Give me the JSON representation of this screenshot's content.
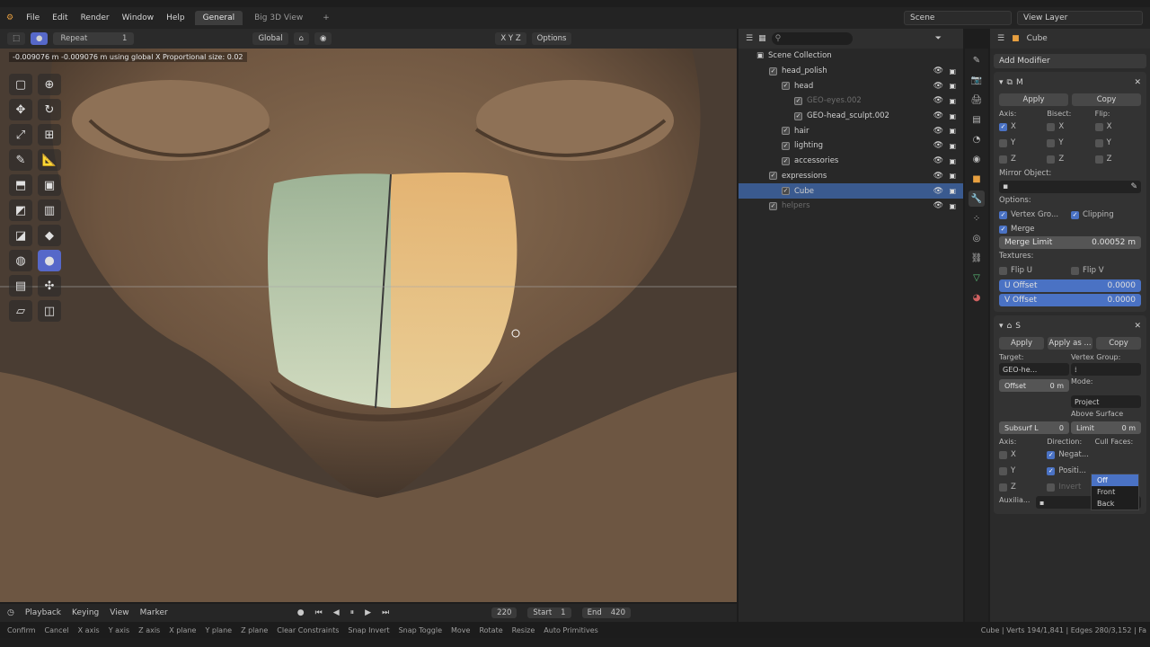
{
  "menu": {
    "file": "File",
    "edit": "Edit",
    "render": "Render",
    "window": "Window",
    "help": "Help"
  },
  "workspace_tabs": [
    "General",
    "Big 3D View"
  ],
  "scene": "Scene",
  "view_layer": "View Layer",
  "viewport_header": {
    "operator": "Repeat",
    "operator_value": "1",
    "orientation": "Global",
    "axes": "X  Y  Z",
    "options": "Options"
  },
  "op_status": "-0.009076 m -0.009076 m using global X     Proportional size: 0.02",
  "timeline": {
    "playback": "Playback",
    "keying": "Keying",
    "view": "View",
    "marker": "Marker",
    "frame": "220",
    "start_label": "Start",
    "start": "1",
    "end_label": "End",
    "end": "420"
  },
  "statusbar": {
    "items": [
      "Confirm",
      "Cancel",
      "X axis",
      "Y axis",
      "Z axis",
      "X plane",
      "Y plane",
      "Z plane",
      "Clear Constraints",
      "Snap Invert",
      "Snap Toggle",
      "Move",
      "Rotate",
      "Resize",
      "Auto Primitives"
    ],
    "stats": "Cube | Verts 194/1,841 | Edges 280/3,152 | Fa"
  },
  "outliner": {
    "title": "Scene Collection",
    "rows": [
      {
        "label": "head_polish",
        "indent": 1,
        "dim": false
      },
      {
        "label": "head",
        "indent": 2,
        "dim": false
      },
      {
        "label": "GEO-eyes.002",
        "indent": 3,
        "dim": true
      },
      {
        "label": "GEO-head_sculpt.002",
        "indent": 3,
        "dim": false
      },
      {
        "label": "hair",
        "indent": 2,
        "dim": false
      },
      {
        "label": "lighting",
        "indent": 2,
        "dim": false
      },
      {
        "label": "accessories",
        "indent": 2,
        "dim": false
      },
      {
        "label": "expressions",
        "indent": 1,
        "dim": false
      },
      {
        "label": "Cube",
        "indent": 2,
        "dim": false,
        "selected": true
      },
      {
        "label": "helpers",
        "indent": 1,
        "dim": true
      }
    ]
  },
  "props": {
    "object": "Cube",
    "add_modifier": "Add Modifier",
    "mirror": {
      "name": "M",
      "apply": "Apply",
      "copy": "Copy",
      "axis": "Axis:",
      "bisect": "Bisect:",
      "flip": "Flip:",
      "x": "X",
      "y": "Y",
      "z": "Z",
      "mirror_object": "Mirror Object:",
      "options": "Options:",
      "vertex_groups": "Vertex Gro...",
      "clipping": "Clipping",
      "merge": "Merge",
      "merge_limit": "Merge Limit",
      "merge_limit_value": "0.00052 m",
      "textures": "Textures:",
      "flip_u": "Flip U",
      "flip_v": "Flip V",
      "u_offset": "U Offset",
      "u_offset_value": "0.0000",
      "v_offset": "V Offset",
      "v_offset_value": "0.0000"
    },
    "shrinkwrap": {
      "name": "S",
      "apply": "Apply",
      "apply_as": "Apply as ...",
      "copy": "Copy",
      "target": "Target:",
      "target_value": "GEO-he...",
      "vertex_group": "Vertex Group:",
      "offset": "Offset",
      "offset_value": "0 m",
      "mode": "Mode:",
      "mode_value": "Project",
      "above_surface": "Above Surface",
      "subsurf": "Subsurf L",
      "subsurf_value": "0",
      "limit": "Limit",
      "limit_value": "0 m",
      "axis": "Axis:",
      "direction": "Direction:",
      "cull_faces": "Cull Faces:",
      "negative": "Negat...",
      "positive": "Positi...",
      "invert": "Invert",
      "cull_options": [
        "Off",
        "Front",
        "Back"
      ],
      "auxiliary": "Auxilia..."
    }
  }
}
